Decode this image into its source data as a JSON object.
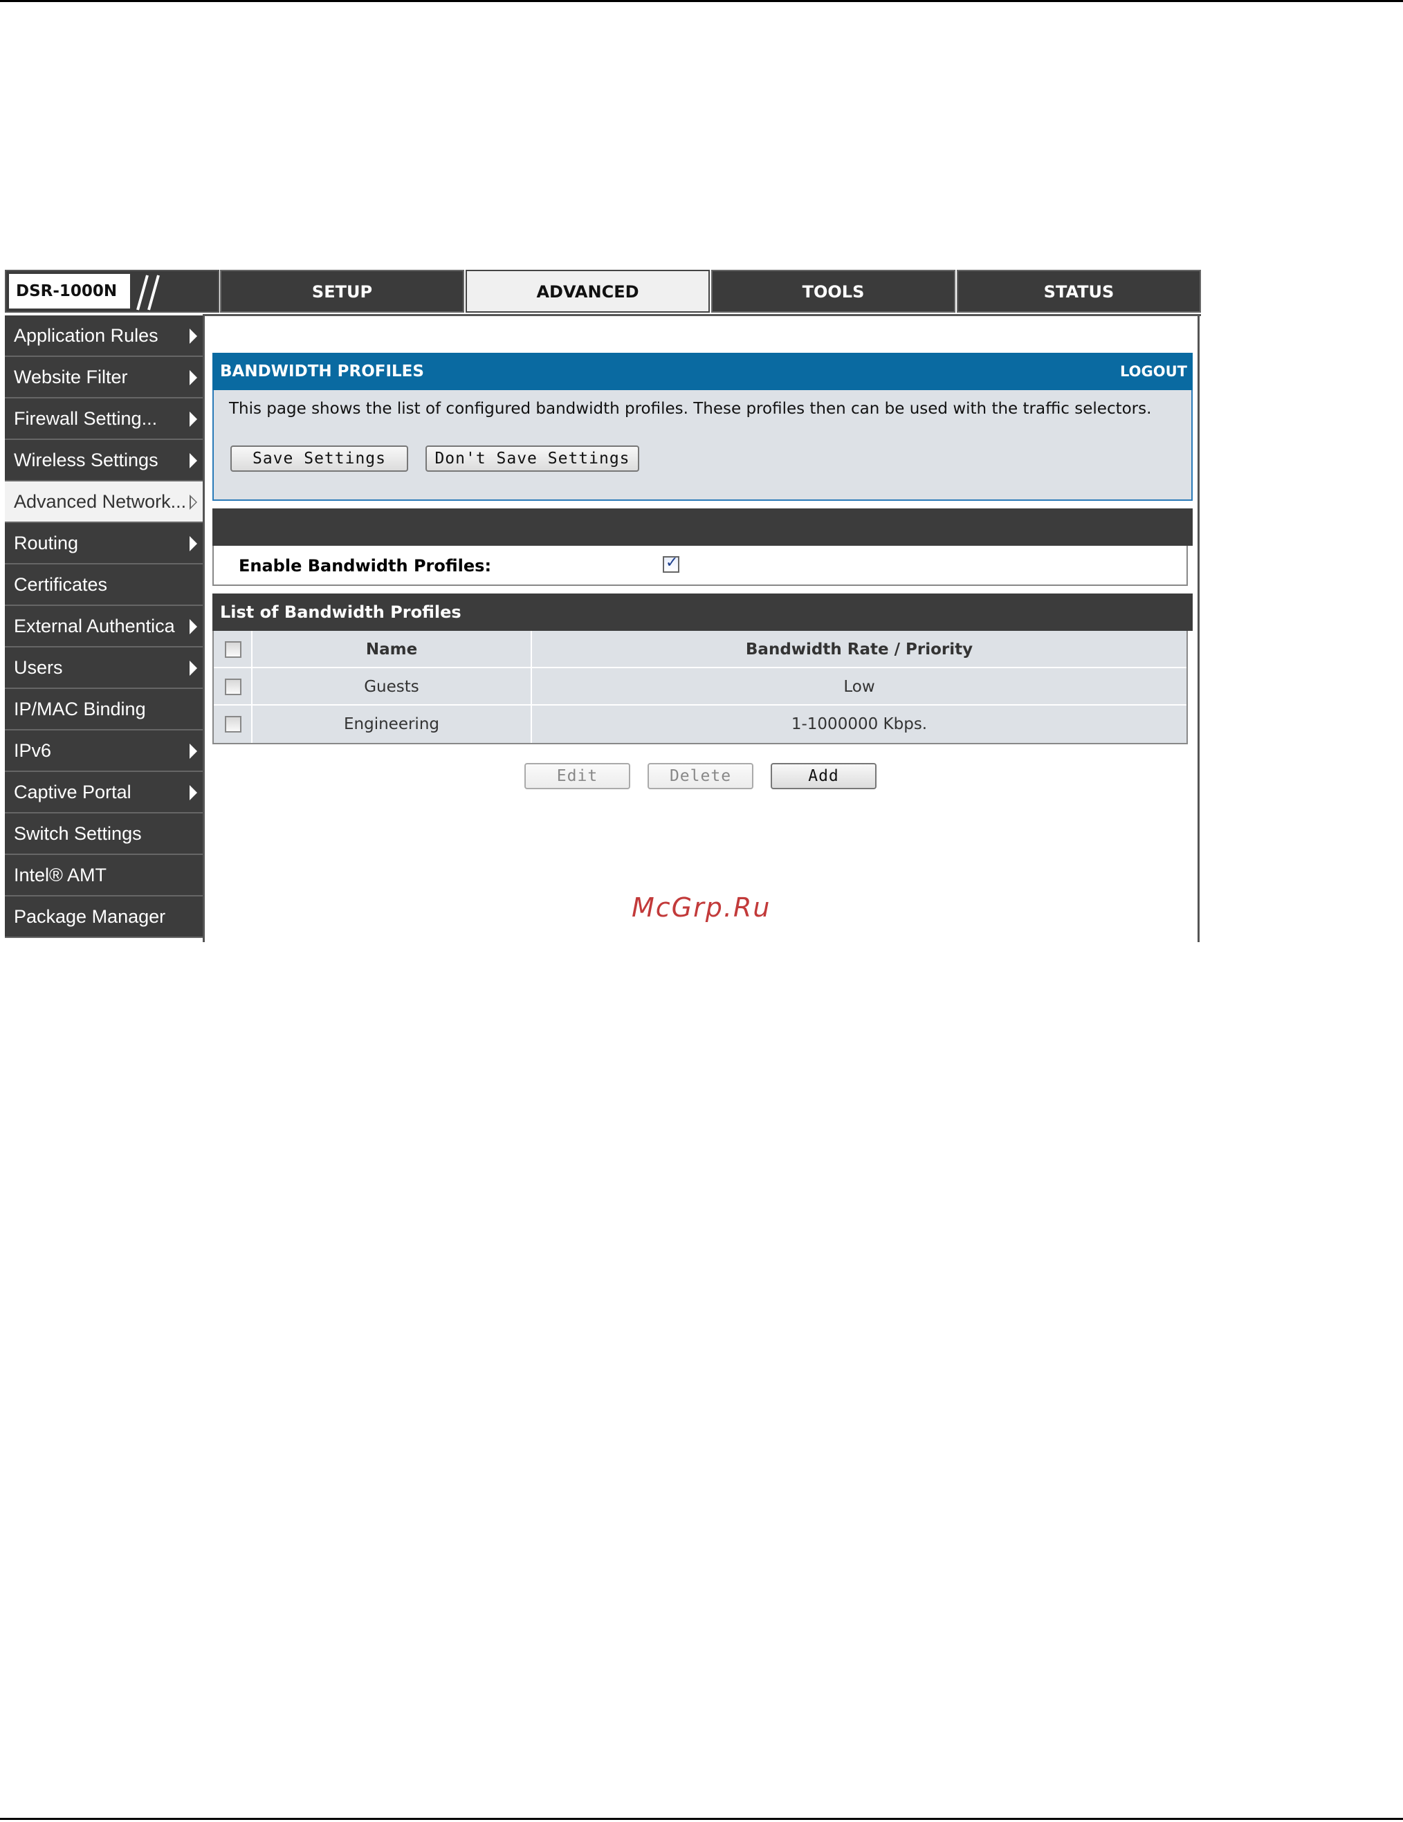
{
  "product": {
    "model": "DSR-1000N"
  },
  "tabs": [
    {
      "label": "SETUP",
      "active": false
    },
    {
      "label": "ADVANCED",
      "active": true
    },
    {
      "label": "TOOLS",
      "active": false
    },
    {
      "label": "STATUS",
      "active": false
    }
  ],
  "sidebar": {
    "items": [
      {
        "label": "Application Rules",
        "arrow": "filled"
      },
      {
        "label": "Website Filter",
        "arrow": "filled"
      },
      {
        "label": "Firewall Setting...",
        "arrow": "filled"
      },
      {
        "label": "Wireless Settings",
        "arrow": "filled"
      },
      {
        "label": "Advanced Network...",
        "arrow": "hollow",
        "active": true
      },
      {
        "label": "Routing",
        "arrow": "filled"
      },
      {
        "label": "Certificates",
        "arrow": "none"
      },
      {
        "label": "External Authentica",
        "arrow": "filled"
      },
      {
        "label": "Users",
        "arrow": "filled"
      },
      {
        "label": "IP/MAC Binding",
        "arrow": "none"
      },
      {
        "label": "IPv6",
        "arrow": "filled"
      },
      {
        "label": "Captive Portal",
        "arrow": "filled"
      },
      {
        "label": "Switch Settings",
        "arrow": "none"
      },
      {
        "label": "Intel® AMT",
        "arrow": "none"
      },
      {
        "label": "Package Manager",
        "arrow": "none"
      }
    ]
  },
  "section": {
    "title": "BANDWIDTH PROFILES",
    "logout": "LOGOUT",
    "description": "This page shows the list of configured bandwidth profiles. These profiles then can be used with the traffic selectors.",
    "save_label": "Save Settings",
    "dont_save_label": "Don't Save Settings"
  },
  "enable": {
    "label": "Enable Bandwidth Profiles:",
    "checked": true
  },
  "list": {
    "title": "List of Bandwidth Profiles",
    "columns": {
      "name": "Name",
      "rate": "Bandwidth Rate / Priority"
    },
    "rows": [
      {
        "name": "Guests",
        "rate": "Low"
      },
      {
        "name": "Engineering",
        "rate": "1-1000000 Kbps."
      }
    ],
    "actions": {
      "edit": "Edit",
      "delete": "Delete",
      "add": "Add"
    }
  },
  "watermark": "McGrp.Ru"
}
